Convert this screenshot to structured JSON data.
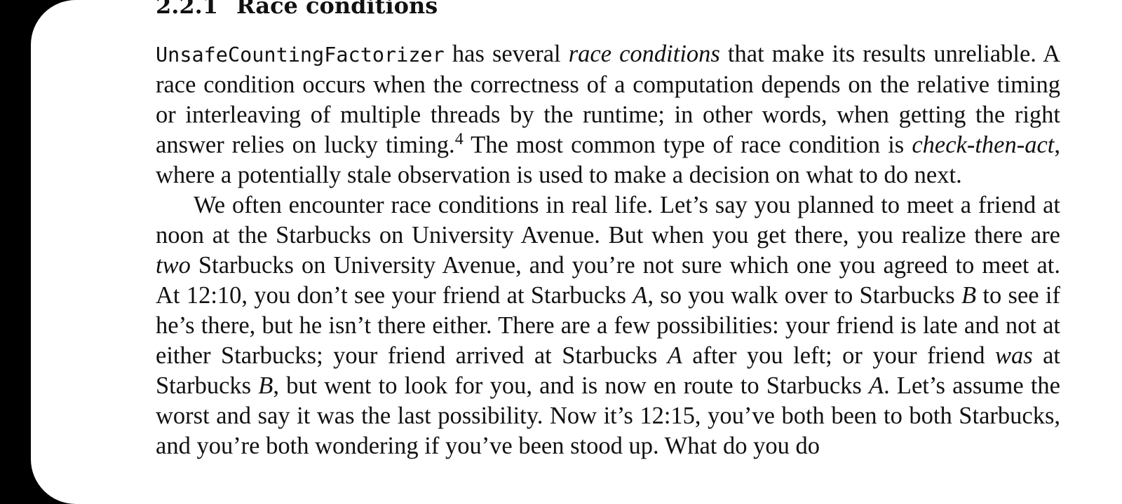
{
  "section": {
    "number": "2.2.1",
    "title": "Race conditions"
  },
  "paragraph1": {
    "class_name": "UnsafeCountingFactorizer",
    "t1": " has several ",
    "em1": "race conditions",
    "t2": " that make its results unreliable. A race condition occurs when the correctness of a computation depends on the relative timing or interleaving of multiple threads by the runtime; in other words, when getting the right answer relies on lucky timing.",
    "footnote": "4",
    "t3": " The most common type of race condition is ",
    "em2": "check-then-act",
    "t4": ", where a potentially stale observation is used to make a decision on what to do next."
  },
  "paragraph2": {
    "t1": "We often encounter race conditions in real life. Let’s say you planned to meet a friend at noon at the Starbucks on University Avenue. But when you get there, you realize there are ",
    "em1": "two",
    "t2": " Starbucks on University Avenue, and you’re not sure which one you agreed to meet at. At 12:10, you don’t see your friend at Starbucks ",
    "em2": "A",
    "t3": ", so you walk over to Starbucks ",
    "em3": "B",
    "t4": " to see if he’s there, but he isn’t there either. There are a few possibilities: your friend is late and not at either Starbucks; your friend arrived at Starbucks ",
    "em4": "A",
    "t5": " after you left; or your friend ",
    "em5": "was",
    "t6": " at Starbucks ",
    "em6": "B",
    "t7": ", but went to look for you, and is now en route to Starbucks ",
    "em7": "A",
    "t8": ". Let’s assume the worst and say it was the last possibility. Now it’s 12:15, you’ve both been to both Starbucks, and you’re both wondering if you’ve been stood up. What do you do"
  }
}
